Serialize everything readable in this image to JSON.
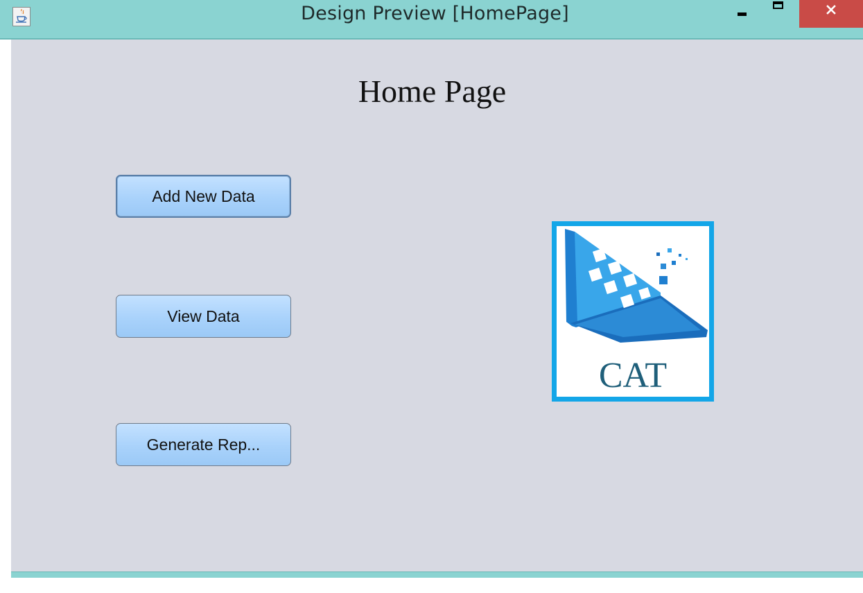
{
  "window": {
    "title": "Design Preview [HomePage]",
    "app_icon": "java-coffee-icon",
    "controls": {
      "minimize_icon": "minimize-icon",
      "maximize_icon": "maximize-icon",
      "close_icon": "close-icon"
    }
  },
  "page": {
    "title": "Home Page"
  },
  "buttons": {
    "add_new_data": "Add New Data",
    "view_data": "View Data",
    "generate_report": "Generate Rep..."
  },
  "logo": {
    "text": "CAT",
    "border_color": "#13a6e8"
  },
  "colors": {
    "titlebar": "#8ad3d1",
    "content_background": "#d7d9e2",
    "button_fill": "#a9d2fb",
    "close_button": "#c94b47"
  }
}
